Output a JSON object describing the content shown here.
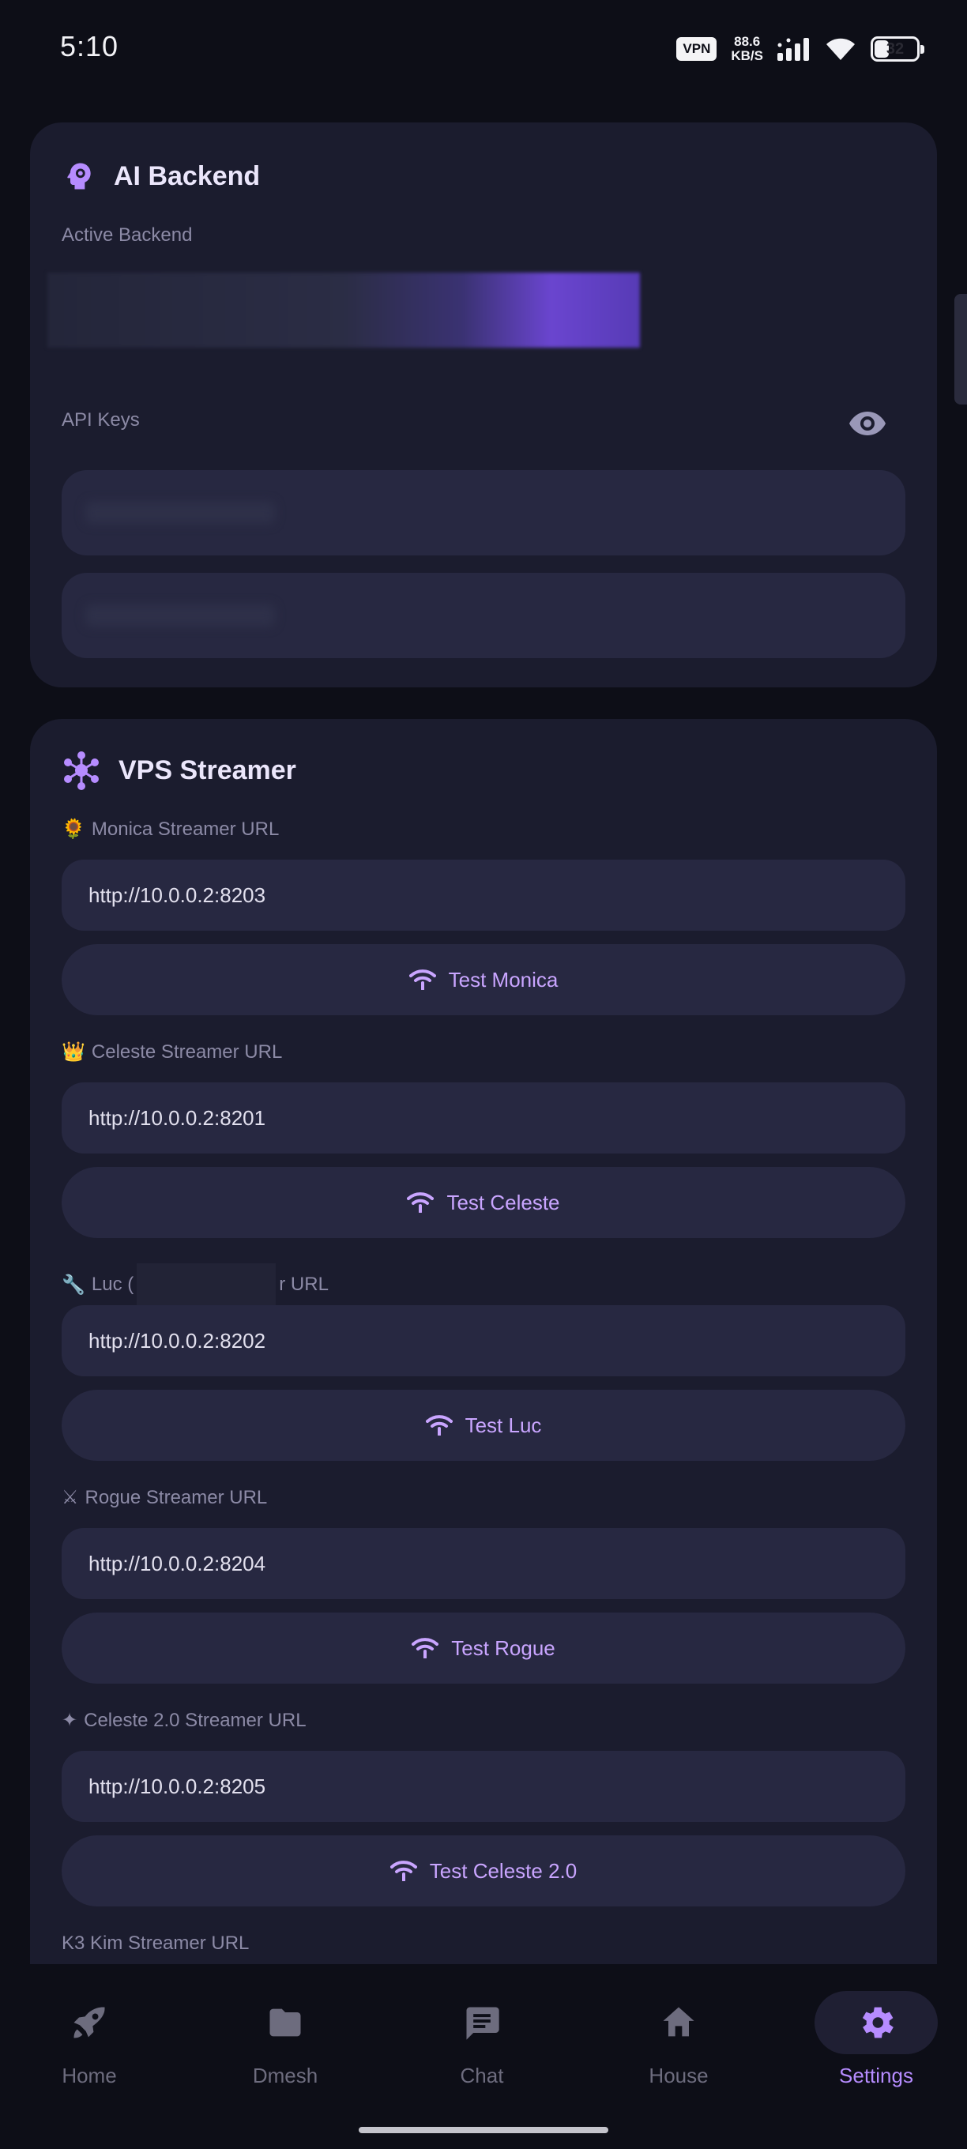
{
  "status_bar": {
    "time": "5:10",
    "vpn": "VPN",
    "speed_value": "88.6",
    "speed_unit": "KB/S",
    "battery": "32"
  },
  "ai_backend": {
    "title": "AI Backend",
    "active_backend_label": "Active Backend",
    "api_keys_label": "API Keys"
  },
  "vps": {
    "title": "VPS Streamer",
    "streamers": [
      {
        "emoji": "🌻",
        "label": "Monica Streamer URL",
        "url": "http://10.0.0.2:8203",
        "button": "Test Monica"
      },
      {
        "emoji": "👑",
        "label": "Celeste Streamer URL",
        "url": "http://10.0.0.2:8201",
        "button": "Test Celeste"
      },
      {
        "emoji": "🔧",
        "label": "Luc (",
        "label_tail": "r URL",
        "url": "http://10.0.0.2:8202",
        "button": "Test Luc"
      },
      {
        "emoji": "⚔",
        "label": "Rogue Streamer URL",
        "url": "http://10.0.0.2:8204",
        "button": "Test Rogue"
      },
      {
        "emoji": "✦",
        "label": "Celeste 2.0 Streamer URL",
        "url": "http://10.0.0.2:8205",
        "button": "Test Celeste 2.0"
      }
    ],
    "next_label": "K3 Kim Streamer URL"
  },
  "nav": {
    "items": [
      {
        "label": "Home",
        "icon": "rocket-icon"
      },
      {
        "label": "Dmesh",
        "icon": "folder-icon"
      },
      {
        "label": "Chat",
        "icon": "chat-icon"
      },
      {
        "label": "House",
        "icon": "house-icon"
      },
      {
        "label": "Settings",
        "icon": "gear-icon",
        "active": true
      }
    ]
  },
  "colors": {
    "background": "#0d0e17",
    "card": "#1b1c2e",
    "field": "#272841",
    "accent": "#b68cff",
    "muted": "#8c8aa6"
  }
}
